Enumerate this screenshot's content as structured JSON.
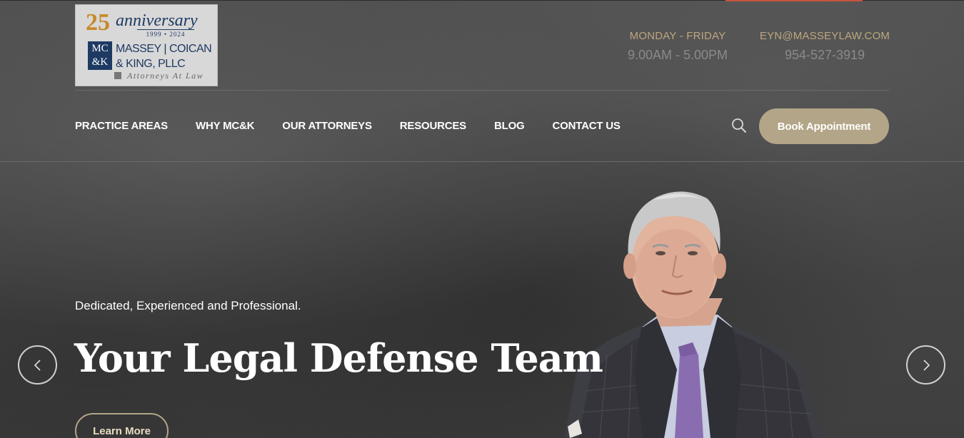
{
  "brand": {
    "anniversary_number": "25",
    "anniversary_word": "anniversary",
    "anniversary_years": "1999 • 2024",
    "mark": [
      "MC",
      "&K"
    ],
    "firm_lines": [
      "MASSEY | COICAN",
      "& KING, PLLC"
    ],
    "tagline": "Attorneys At Law"
  },
  "header": {
    "hours_label": "MONDAY - FRIDAY",
    "hours_value": "9.00AM - 5.00PM",
    "email": "EYN@MASSEYLAW.COM",
    "phone": "954-527-3919"
  },
  "nav": {
    "items": [
      {
        "label": "PRACTICE AREAS"
      },
      {
        "label": "WHY MC&K"
      },
      {
        "label": "OUR ATTORNEYS"
      },
      {
        "label": "RESOURCES"
      },
      {
        "label": "BLOG"
      },
      {
        "label": "CONTACT US"
      }
    ],
    "search_icon": "search-icon",
    "book_label": "Book Appointment"
  },
  "hero": {
    "subtitle": "Dedicated, Experienced and Professional.",
    "title": "Your Legal Defense Team",
    "cta_label": "Learn More",
    "prev_icon": "chevron-left-icon",
    "next_icon": "chevron-right-icon"
  },
  "colors": {
    "accent": "#b3a587",
    "info_label": "#bda77f",
    "top_accent": "#c8553d",
    "logo_navy": "#1e3a63"
  }
}
